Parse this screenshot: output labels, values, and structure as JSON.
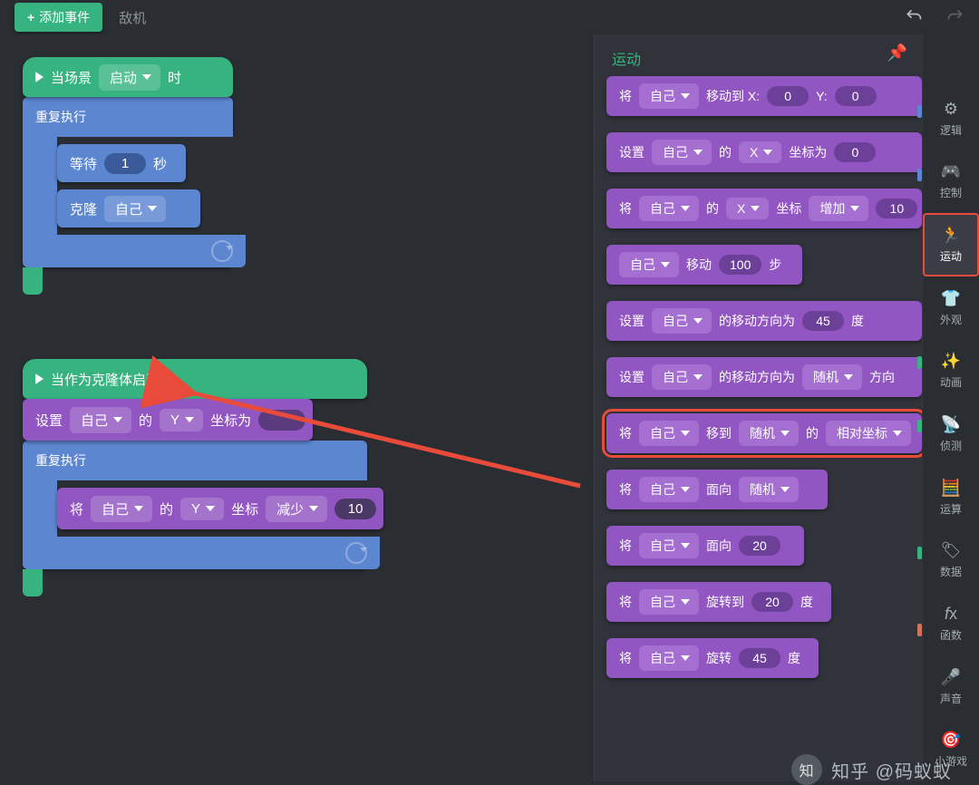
{
  "topbar": {
    "add_event": "添加事件",
    "tab_enemy": "敌机"
  },
  "canvas": {
    "hat1_prefix": "当场景",
    "hat1_dd": "启动",
    "hat1_suffix": "时",
    "loop_label": "重复执行",
    "wait_prefix": "等待",
    "wait_value": "1",
    "wait_suffix": "秒",
    "clone_prefix": "克隆",
    "clone_dd": "自己",
    "hat2": "当作为克隆体启动时",
    "set_prefix": "设置",
    "dd_self": "自己",
    "mid_de": "的",
    "axis_y": "Y",
    "set_suffix": "坐标为",
    "inc_prefix": "将",
    "inc_mid": "坐标",
    "inc_op": "减少",
    "inc_val": "10"
  },
  "panel": {
    "title": "运动",
    "b1": {
      "a": "将",
      "self": "自己",
      "mid": "移动到 X:",
      "x": "0",
      "y": "Y:",
      "yv": "0"
    },
    "b2": {
      "a": "设置",
      "self": "自己",
      "de": "的",
      "axis": "X",
      "suf": "坐标为",
      "v": "0"
    },
    "b3": {
      "a": "将",
      "self": "自己",
      "de": "的",
      "axis": "X",
      "mid": "坐标",
      "op": "增加",
      "v": "10"
    },
    "b4": {
      "self": "自己",
      "mid": "移动",
      "v": "100",
      "suf": "步"
    },
    "b5": {
      "a": "设置",
      "self": "自己",
      "mid": "的移动方向为",
      "v": "45",
      "suf": "度"
    },
    "b6": {
      "a": "设置",
      "self": "自己",
      "mid": "的移动方向为",
      "dd": "随机",
      "suf": "方向"
    },
    "b7": {
      "a": "将",
      "self": "自己",
      "mid": "移到",
      "dd": "随机",
      "de": "的",
      "dd2": "相对坐标"
    },
    "b8": {
      "a": "将",
      "self": "自己",
      "mid": "面向",
      "dd": "随机"
    },
    "b9": {
      "a": "将",
      "self": "自己",
      "mid": "面向",
      "v": "20"
    },
    "b10": {
      "a": "将",
      "self": "自己",
      "mid": "旋转到",
      "v": "20",
      "suf": "度"
    },
    "b11": {
      "a": "将",
      "self": "自己",
      "mid": "旋转",
      "v": "45",
      "suf": "度"
    }
  },
  "cats": {
    "logic": "逻辑",
    "control": "控制",
    "motion": "运动",
    "look": "外观",
    "anim": "动画",
    "sense": "侦测",
    "calc": "运算",
    "data": "数据",
    "func": "函数",
    "sound": "声音",
    "mini": "小游戏"
  },
  "watermark": {
    "text": "知乎 @码蚁蚁"
  }
}
